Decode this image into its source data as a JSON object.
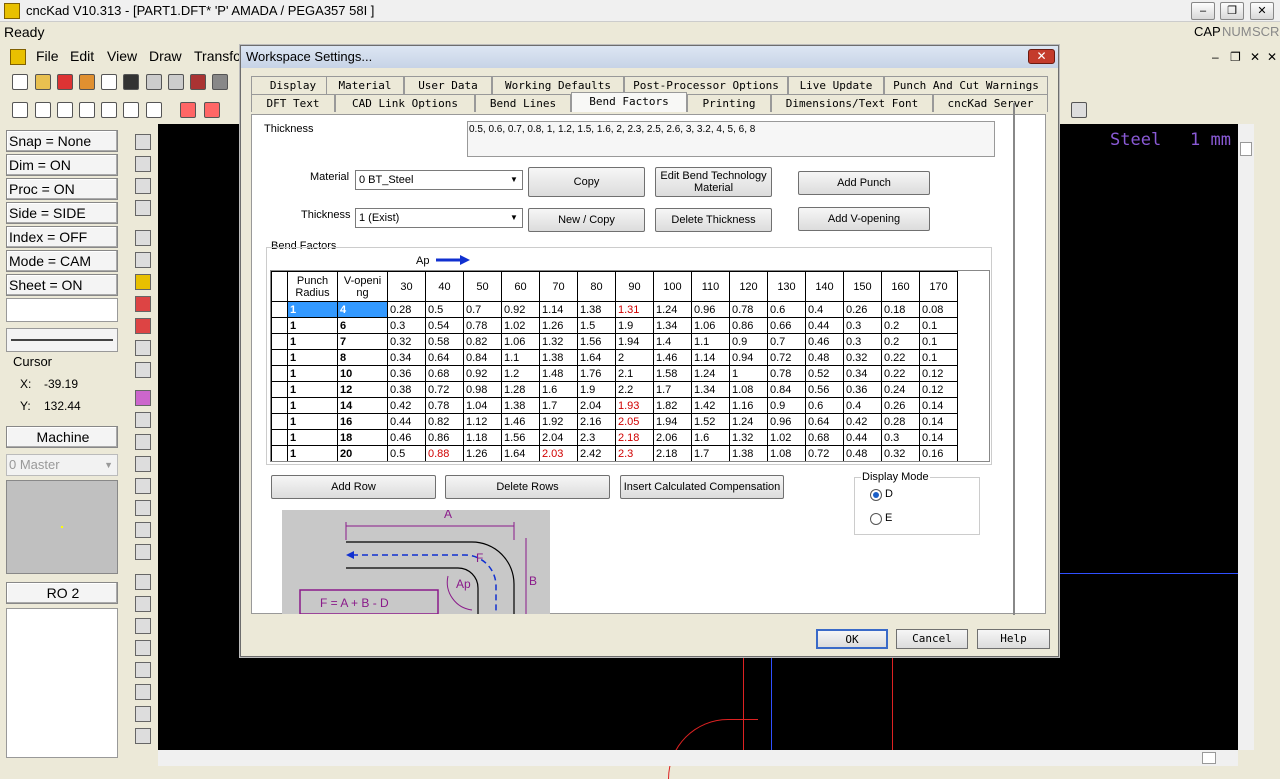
{
  "app": {
    "title": "cncKad V10.313 - [PART1.DFT*  'P'  AMADA / PEGA357    58I   ]",
    "status_left": "Ready",
    "status_right": [
      "CAP",
      "NUM",
      "SCRL"
    ]
  },
  "menu": [
    "File",
    "Edit",
    "View",
    "Draw",
    "Transfo"
  ],
  "left_panel": {
    "buttons": [
      "Snap = None",
      "Dim   = ON",
      "Proc  = ON",
      "Side  = SIDE",
      "Index = OFF",
      "Mode = CAM",
      "Sheet = ON"
    ],
    "cursor_label": "Cursor",
    "x_label": "X:",
    "x_value": "-39.19",
    "y_label": "Y:",
    "y_value": "132.44",
    "machine_button": "Machine",
    "master_select": "0 Master",
    "ro_button": "RO 2"
  },
  "canvas": {
    "material_text": "Steel",
    "thickness_text": "1 mm"
  },
  "dialog": {
    "title": "Workspace Settings...",
    "tabs_row1": [
      "Display",
      "Material",
      "User Data",
      "Working Defaults",
      "Post-Processor Options",
      "Live Update",
      "Punch And Cut Warnings"
    ],
    "tabs_row2": [
      "DFT Text",
      "CAD Link Options",
      "Bend Lines",
      "Bend Factors",
      "Printing",
      "Dimensions/Text Font",
      "cncKad Server"
    ],
    "active_tab": "Bend Factors",
    "thickness_label": "Thickness",
    "thickness_list": "0.5, 0.6, 0.7, 0.8, 1, 1.2, 1.5, 1.6, 2, 2.3, 2.5, 2.6, 3, 3.2, 4, 5, 6, 8",
    "material_label": "Material",
    "material_value": "0   BT_Steel",
    "thickness_select_label": "Thickness",
    "thickness_select_value": "1 (Exist)",
    "copy_button": "Copy",
    "new_copy_button": "New / Copy",
    "edit_bend_button_line1": "Edit Bend Technology",
    "edit_bend_button_line2": "Material",
    "delete_thickness_button": "Delete Thickness",
    "add_punch_button": "Add Punch",
    "add_vopening_button": "Add V-opening",
    "bend_factors_label": "Bend Factors",
    "ap_label": "Ap",
    "table_headers": [
      "Punch\nRadius",
      "V-openi\nng",
      "30",
      "40",
      "50",
      "60",
      "70",
      "80",
      "90",
      "100",
      "110",
      "120",
      "130",
      "140",
      "150",
      "160",
      "170"
    ],
    "rows": [
      {
        "r": "1",
        "v": "4",
        "vals": [
          "0.28",
          "0.5",
          "0.7",
          "0.92",
          "1.14",
          "1.38",
          "1.31",
          "1.24",
          "0.96",
          "0.78",
          "0.6",
          "0.4",
          "0.26",
          "0.18",
          "0.08"
        ],
        "red": [
          6
        ]
      },
      {
        "r": "1",
        "v": "6",
        "vals": [
          "0.3",
          "0.54",
          "0.78",
          "1.02",
          "1.26",
          "1.5",
          "1.9",
          "1.34",
          "1.06",
          "0.86",
          "0.66",
          "0.44",
          "0.3",
          "0.2",
          "0.1"
        ],
        "red": []
      },
      {
        "r": "1",
        "v": "7",
        "vals": [
          "0.32",
          "0.58",
          "0.82",
          "1.06",
          "1.32",
          "1.56",
          "1.94",
          "1.4",
          "1.1",
          "0.9",
          "0.7",
          "0.46",
          "0.3",
          "0.2",
          "0.1"
        ],
        "red": []
      },
      {
        "r": "1",
        "v": "8",
        "vals": [
          "0.34",
          "0.64",
          "0.84",
          "1.1",
          "1.38",
          "1.64",
          "2",
          "1.46",
          "1.14",
          "0.94",
          "0.72",
          "0.48",
          "0.32",
          "0.22",
          "0.1"
        ],
        "red": []
      },
      {
        "r": "1",
        "v": "10",
        "vals": [
          "0.36",
          "0.68",
          "0.92",
          "1.2",
          "1.48",
          "1.76",
          "2.1",
          "1.58",
          "1.24",
          "1",
          "0.78",
          "0.52",
          "0.34",
          "0.22",
          "0.12"
        ],
        "red": []
      },
      {
        "r": "1",
        "v": "12",
        "vals": [
          "0.38",
          "0.72",
          "0.98",
          "1.28",
          "1.6",
          "1.9",
          "2.2",
          "1.7",
          "1.34",
          "1.08",
          "0.84",
          "0.56",
          "0.36",
          "0.24",
          "0.12"
        ],
        "red": []
      },
      {
        "r": "1",
        "v": "14",
        "vals": [
          "0.42",
          "0.78",
          "1.04",
          "1.38",
          "1.7",
          "2.04",
          "1.93",
          "1.82",
          "1.42",
          "1.16",
          "0.9",
          "0.6",
          "0.4",
          "0.26",
          "0.14"
        ],
        "red": [
          6
        ]
      },
      {
        "r": "1",
        "v": "16",
        "vals": [
          "0.44",
          "0.82",
          "1.12",
          "1.46",
          "1.92",
          "2.16",
          "2.05",
          "1.94",
          "1.52",
          "1.24",
          "0.96",
          "0.64",
          "0.42",
          "0.28",
          "0.14"
        ],
        "red": [
          6
        ]
      },
      {
        "r": "1",
        "v": "18",
        "vals": [
          "0.46",
          "0.86",
          "1.18",
          "1.56",
          "2.04",
          "2.3",
          "2.18",
          "2.06",
          "1.6",
          "1.32",
          "1.02",
          "0.68",
          "0.44",
          "0.3",
          "0.14"
        ],
        "red": [
          6
        ]
      },
      {
        "r": "1",
        "v": "20",
        "vals": [
          "0.5",
          "0.88",
          "1.26",
          "1.64",
          "2.03",
          "2.42",
          "2.3",
          "2.18",
          "1.7",
          "1.38",
          "1.08",
          "0.72",
          "0.48",
          "0.32",
          "0.16"
        ],
        "red": [
          1,
          4,
          6
        ]
      }
    ],
    "add_row_button": "Add Row",
    "delete_rows_button": "Delete Rows",
    "insert_comp_button": "Insert Calculated Compensation",
    "display_mode_label": "Display Mode",
    "mode_d": "D",
    "mode_e": "E",
    "diagram": {
      "a": "A",
      "b": "B",
      "f": "F",
      "ap": "Ap",
      "formula": "F = A + B - D"
    },
    "ok_button": "OK",
    "cancel_button": "Cancel",
    "help_button": "Help"
  }
}
